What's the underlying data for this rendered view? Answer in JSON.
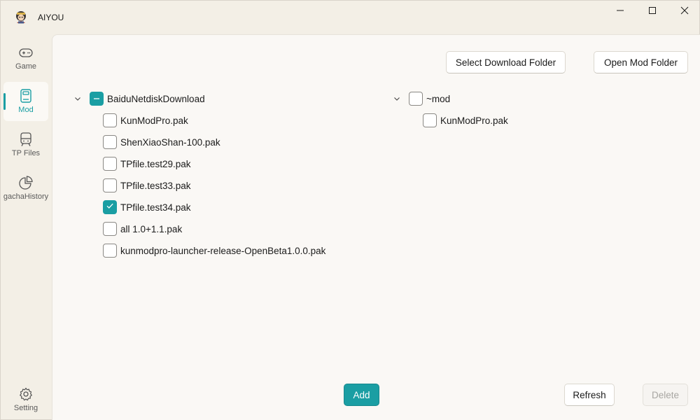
{
  "window": {
    "title": "AIYOU",
    "app_icon": "character-avatar-icon",
    "controls": [
      "minimize-icon",
      "maximize-icon",
      "close-icon"
    ]
  },
  "sidebar": {
    "items": [
      {
        "label": "Game",
        "icon": "gamepad-icon",
        "active": false
      },
      {
        "label": "Mod",
        "icon": "book-icon",
        "active": true
      },
      {
        "label": "TP Files",
        "icon": "train-icon",
        "active": false
      },
      {
        "label": "gachaHistory",
        "icon": "pie-chart-icon",
        "active": false
      }
    ],
    "footer": {
      "label": "Setting",
      "icon": "gear-icon"
    }
  },
  "toolbar": {
    "select_download_folder": "Select Download Folder",
    "open_mod_folder": "Open Mod Folder"
  },
  "left_tree": {
    "root": {
      "label": "BaiduNetdiskDownload",
      "state": "partial",
      "expanded": true
    },
    "children": [
      {
        "label": "KunModPro.pak",
        "checked": false
      },
      {
        "label": "ShenXiaoShan-100.pak",
        "checked": false
      },
      {
        "label": "TPfile.test29.pak",
        "checked": false
      },
      {
        "label": "TPfile.test33.pak",
        "checked": false
      },
      {
        "label": "TPfile.test34.pak",
        "checked": true
      },
      {
        "label": "all 1.0+1.1.pak",
        "checked": false
      },
      {
        "label": "kunmodpro-launcher-release-OpenBeta1.0.0.pak",
        "checked": false
      }
    ]
  },
  "right_tree": {
    "root": {
      "label": "~mod",
      "state": "unchecked",
      "expanded": true
    },
    "children": [
      {
        "label": "KunModPro.pak",
        "checked": false
      }
    ]
  },
  "actions": {
    "add": "Add",
    "refresh": "Refresh",
    "delete": "Delete"
  },
  "colors": {
    "accent": "#1a9ea3",
    "background": "#f3efe6",
    "panel": "#faf8f5"
  }
}
